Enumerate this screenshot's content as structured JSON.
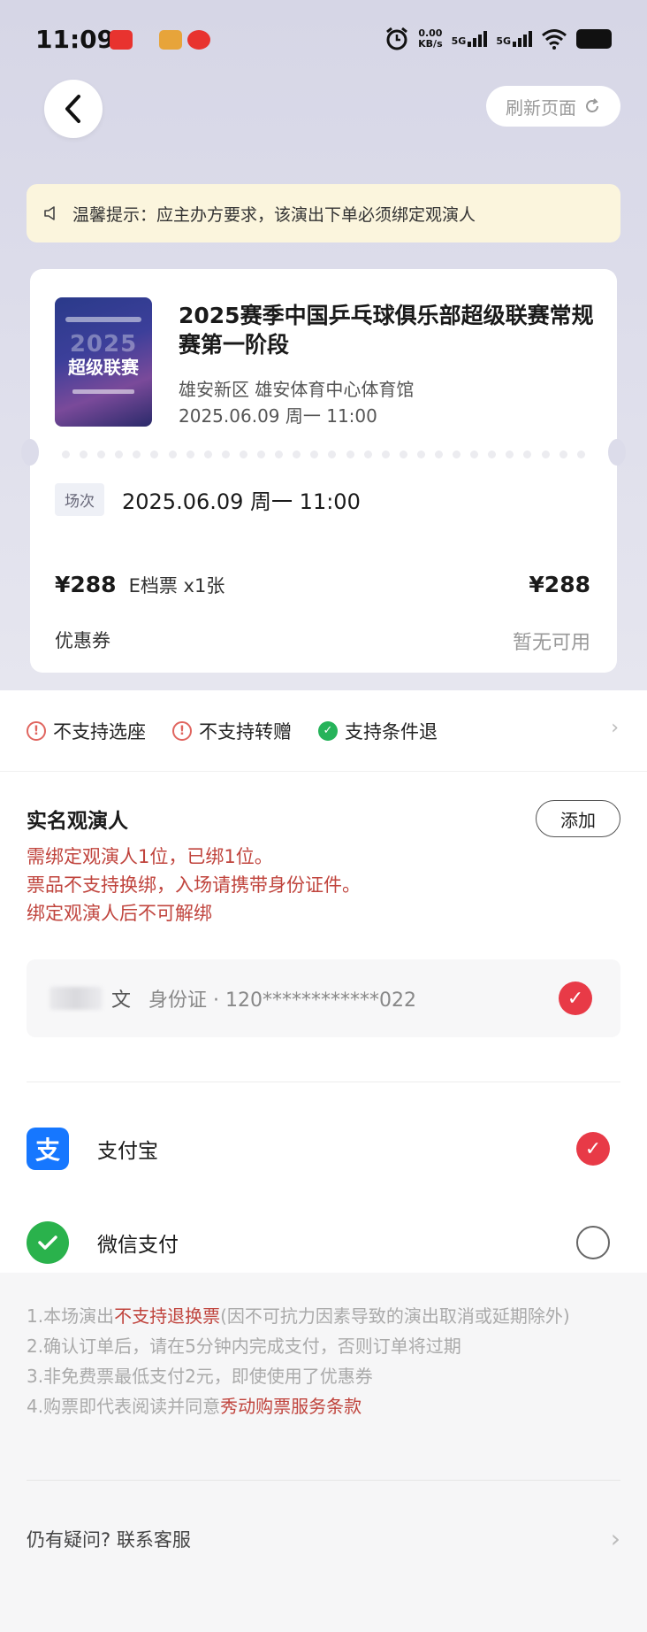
{
  "status_bar": {
    "time": "11:09",
    "net_speed_value": "0.00",
    "net_speed_unit": "KB/s",
    "signal1": "5G",
    "signal2": "5G"
  },
  "nav": {
    "back_icon": "chevron-left-icon",
    "refresh_label": "刷新页面"
  },
  "notice": {
    "icon": "speaker-icon",
    "text": "温馨提示：应主办方要求，该演出下单必须绑定观演人"
  },
  "ticket": {
    "poster": {
      "year": "2025",
      "headline": "超级联赛"
    },
    "title": "2025赛季中国乒乓球俱乐部超级联赛常规赛第一阶段",
    "venue": "雄安新区   雄安体育中心体育馆",
    "date": "2025.06.09 周一 11:00",
    "session_tag": "场次",
    "session_value": "2025.06.09 周一 11:00",
    "price": "¥288",
    "ticket_type": "E档票  x1张",
    "price_total": "¥288",
    "coupon_label": "优惠券",
    "coupon_value": "暂无可用"
  },
  "policy": {
    "items": [
      {
        "label": "不支持选座",
        "icon": "warning-icon"
      },
      {
        "label": "不支持转赠",
        "icon": "warning-icon"
      },
      {
        "label": "支持条件退",
        "icon": "check-circle-icon"
      }
    ]
  },
  "attendee": {
    "title": "实名观演人",
    "add_label": "添加",
    "notes": [
      "需绑定观演人1位，已绑1位。",
      "票品不支持换绑，入场请携带身份证件。",
      "绑定观演人后不可解绑"
    ],
    "person": {
      "name": "文",
      "id_text": "身份证 · 120************022",
      "selected": true
    }
  },
  "payment": {
    "methods": [
      {
        "label": "支付宝",
        "icon": "alipay-icon",
        "color": "#1677ff",
        "selected": true
      },
      {
        "label": "微信支付",
        "icon": "wechat-pay-icon",
        "color": "#2ab24c",
        "selected": false
      }
    ]
  },
  "notes": {
    "line1_prefix": "1.本场演出",
    "line1_highlight": "不支持退换票",
    "line1_suffix": "(因不可抗力因素导致的演出取消或延期除外)",
    "line2": "2.确认订单后，请在5分钟内完成支付，否则订单将过期",
    "line3": "3.非免费票最低支付2元，即使使用了优惠券",
    "line4_prefix": "4.购票即代表阅读并同意",
    "line4_link": "秀动购票服务条款"
  },
  "help": {
    "text": "仍有疑问? 联系客服"
  },
  "colors": {
    "accent_red": "#e83a47",
    "notice_bg": "#fbf5dd",
    "warning_text": "#c0443d",
    "success_green": "#26b35a"
  }
}
